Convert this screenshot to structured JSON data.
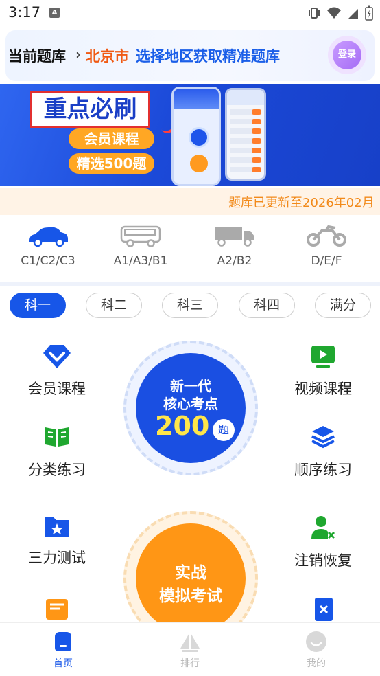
{
  "status": {
    "time": "3:17",
    "notification_icon": "A"
  },
  "header": {
    "current_bank_label": "当前题库",
    "city": "北京市",
    "select_region": "选择地区获取精准题库",
    "login_label": "登录"
  },
  "banner": {
    "title": "重点必刷",
    "pill1": "会员课程",
    "pill2": "精选500题"
  },
  "ticker": {
    "text": "题库已更新至2026年02月"
  },
  "vehicles": [
    {
      "label": "C1/C2/C3",
      "icon": "car-icon"
    },
    {
      "label": "A1/A3/B1",
      "icon": "bus-icon"
    },
    {
      "label": "A2/B2",
      "icon": "truck-icon"
    },
    {
      "label": "D/E/F",
      "icon": "motorcycle-icon"
    }
  ],
  "subjects": [
    {
      "label": "科一",
      "active": true
    },
    {
      "label": "科二",
      "active": false
    },
    {
      "label": "科三",
      "active": false
    },
    {
      "label": "科四",
      "active": false
    },
    {
      "label": "满分",
      "active": false
    }
  ],
  "features": {
    "member_course": "会员课程",
    "video_course": "视频课程",
    "category_practice": "分类练习",
    "sequential_practice": "顺序练习",
    "three_ability_test": "三力测试",
    "cancel_restore": "注销恢复"
  },
  "core_circle": {
    "line1": "新一代",
    "line2": "核心考点",
    "number": "200",
    "unit": "题"
  },
  "exam_circle": {
    "line1": "实战",
    "line2": "模拟考试"
  },
  "bottom_nav": [
    {
      "label": "首页",
      "icon": "home-icon",
      "active": true
    },
    {
      "label": "排行",
      "icon": "ranking-icon",
      "active": false
    },
    {
      "label": "我的",
      "icon": "profile-icon",
      "active": false
    }
  ],
  "colors": {
    "primary": "#1756e8",
    "orange": "#ff9615",
    "green": "#1fa72f",
    "accent_red": "#f05a14"
  }
}
